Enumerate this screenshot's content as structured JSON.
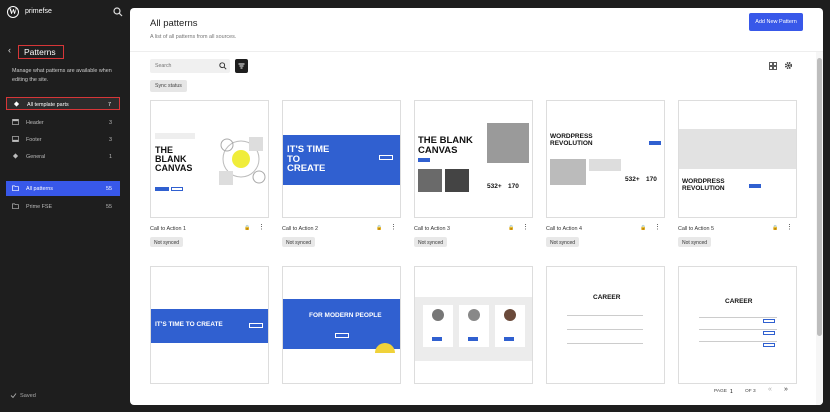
{
  "site": {
    "name": "primefse"
  },
  "sidebar": {
    "title": "Patterns",
    "description": "Manage what patterns are available when editing the site.",
    "template_parts": {
      "label": "All template parts",
      "count": "7"
    },
    "parts": [
      {
        "label": "Header",
        "count": "3"
      },
      {
        "label": "Footer",
        "count": "3"
      },
      {
        "label": "General",
        "count": "1"
      }
    ],
    "categories": [
      {
        "label": "All patterns",
        "count": "55"
      },
      {
        "label": "Prime FSE",
        "count": "55"
      }
    ],
    "status": "Saved"
  },
  "header": {
    "title": "All patterns",
    "description": "A list of all patterns from all sources.",
    "add_button": "Add New Pattern"
  },
  "toolbar": {
    "search_placeholder": "Search",
    "filter_chip": "Sync status"
  },
  "cards": [
    {
      "title": "Call to Action 1",
      "status": "Not synced"
    },
    {
      "title": "Call to Action 2",
      "status": "Not synced"
    },
    {
      "title": "Call to Action 3",
      "status": "Not synced"
    },
    {
      "title": "Call to Action 4",
      "status": "Not synced"
    },
    {
      "title": "Call to Action 5",
      "status": "Not synced"
    }
  ],
  "previews": {
    "blank_canvas": "THE BLANK CANVAS",
    "its_time": "IT'S TIME TO CREATE",
    "wp_revolution": "WORDPRESS REVOLUTION",
    "stat_1": "532+",
    "stat_2": "170",
    "its_time_line": "IT'S TIME TO CREATE",
    "modern_people": "FOR MODERN PEOPLE",
    "career": "CAREER"
  },
  "pagination": {
    "page_label": "PAGE",
    "page": "1",
    "of_label": "OF 3",
    "prev": "«",
    "next": "»"
  },
  "colors": {
    "accent": "#3858e9",
    "highlight": "#d63638",
    "preview_blue": "#3060d0"
  }
}
